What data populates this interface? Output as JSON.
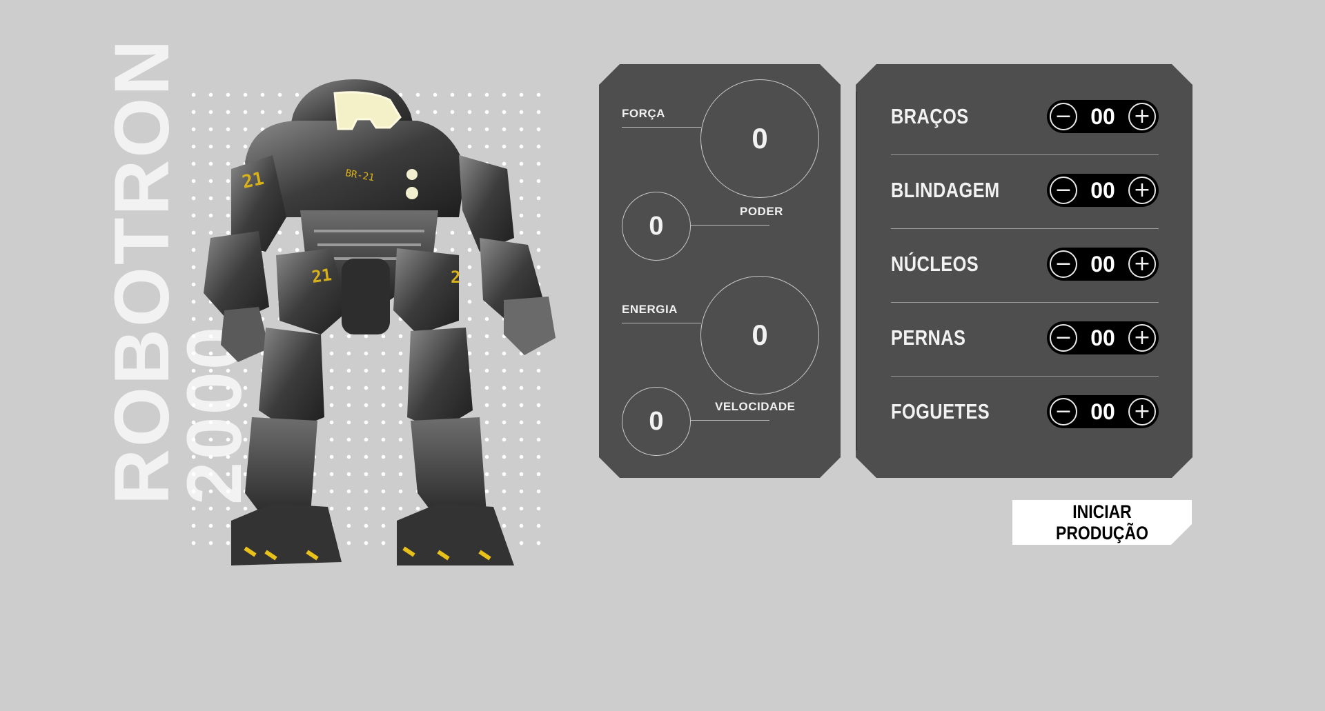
{
  "hero": {
    "title_line1": "ROBOTRON",
    "title_line2": "2000",
    "robot_image_icon": "robot-illustration",
    "robot_markings": [
      "21",
      "BR-21",
      "21",
      "2"
    ]
  },
  "stats": {
    "forca": {
      "label": "FORÇA",
      "value": "0"
    },
    "poder": {
      "label": "PODER",
      "value": "0"
    },
    "energia": {
      "label": "ENERGIA",
      "value": "0"
    },
    "velocidade": {
      "label": "VELOCIDADE",
      "value": "0"
    }
  },
  "parts": [
    {
      "name": "BRAÇOS",
      "value": "00",
      "minus": "−",
      "plus": "+"
    },
    {
      "name": "BLINDAGEM",
      "value": "00",
      "minus": "−",
      "plus": "+"
    },
    {
      "name": "NÚCLEOS",
      "value": "00",
      "minus": "−",
      "plus": "+"
    },
    {
      "name": "PERNAS",
      "value": "00",
      "minus": "−",
      "plus": "+"
    },
    {
      "name": "FOGUETES",
      "value": "00",
      "minus": "−",
      "plus": "+"
    }
  ],
  "actions": {
    "start_label": "INICIAR PRODUÇÃO"
  },
  "colors": {
    "background": "#cdcdcd",
    "panel": "#4e4e4e",
    "accent": "#e8c21a",
    "counter": "#000000"
  }
}
